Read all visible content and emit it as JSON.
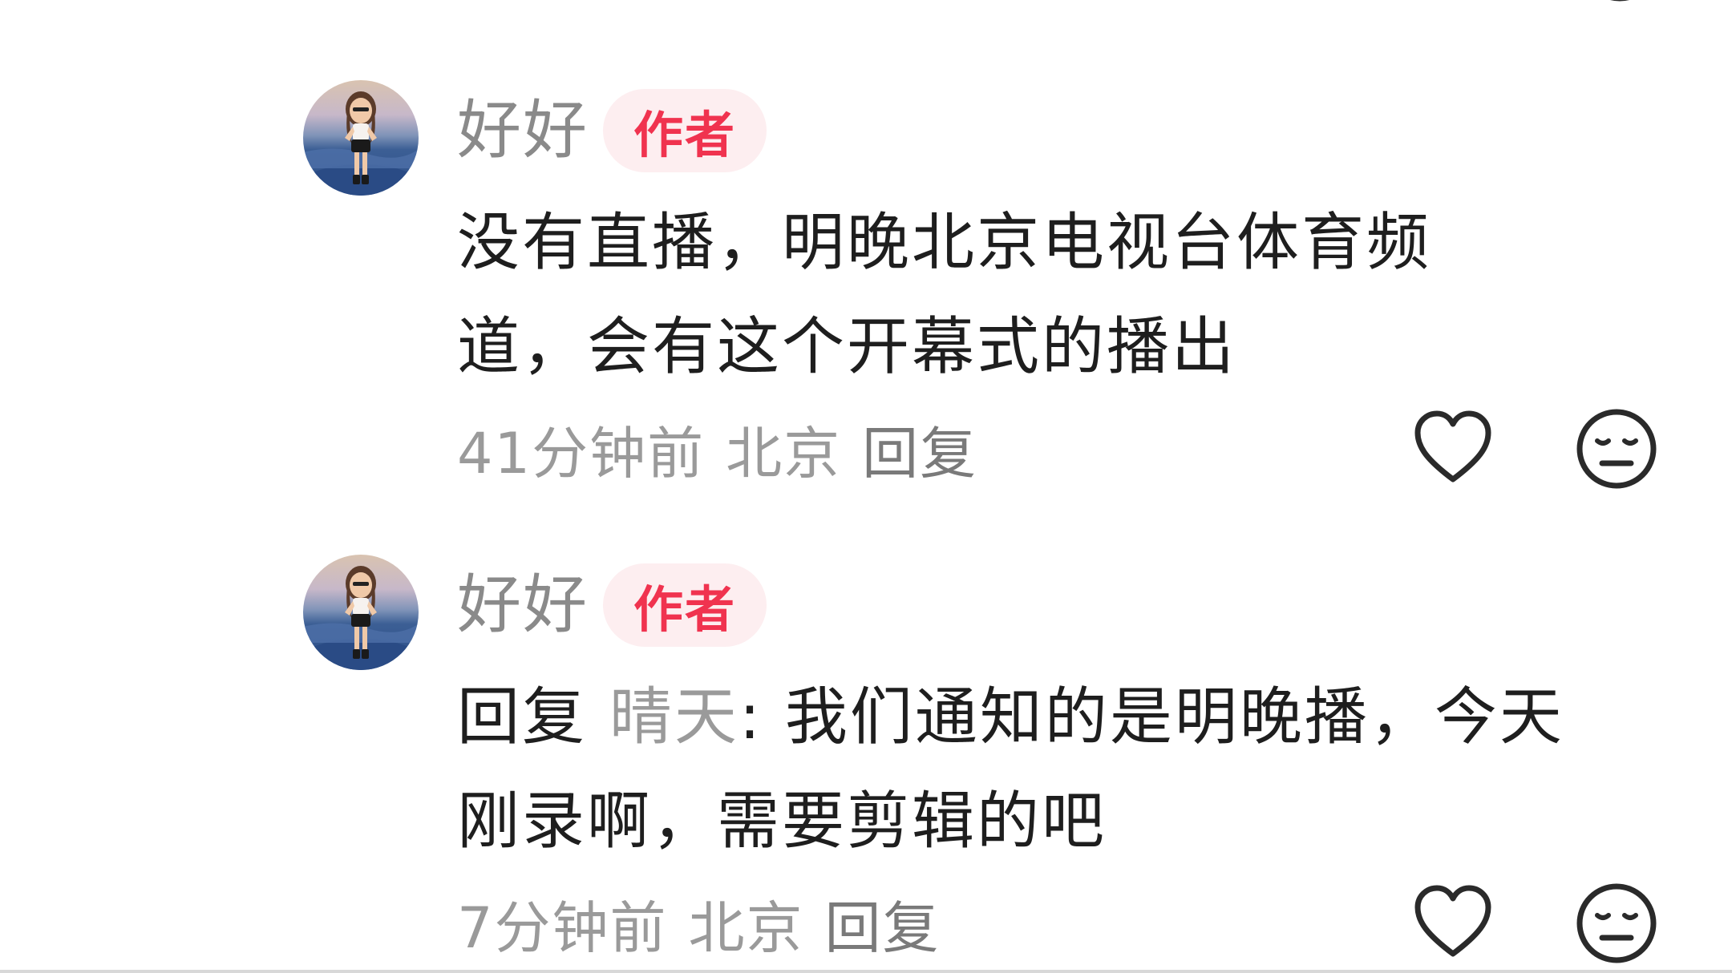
{
  "comments": [
    {
      "username": "好好",
      "badge": "作者",
      "text_line1": "没有直播，明晚北京电视台体育频",
      "text_line2": "道，会有这个开幕式的播出",
      "time": "41分钟前",
      "location": "北京",
      "reply_label": "回复",
      "like_icon": "heart-outline-icon",
      "dislike_icon": "neutral-face-icon"
    },
    {
      "username": "好好",
      "badge": "作者",
      "reply_prefix": "回复",
      "reply_target": "晴天",
      "text_line1": ": 我们通知的是明晚播，今天",
      "text_line2": "刚录啊，需要剪辑的吧",
      "time": "7分钟前",
      "location": "北京",
      "reply_label": "回复",
      "like_icon": "heart-outline-icon",
      "dislike_icon": "neutral-face-icon"
    }
  ],
  "colors": {
    "badge_text": "#f0334f",
    "badge_bg": "#fdeef0",
    "username": "#8a8a8a",
    "body_text": "#1e1e1e",
    "meta_text": "#9a9a9a"
  }
}
